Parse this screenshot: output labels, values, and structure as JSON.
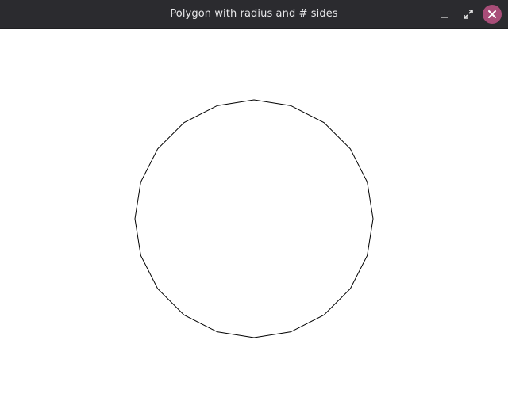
{
  "window": {
    "title": "Polygon with radius and # sides",
    "controls": {
      "minimize_icon": "minimize-icon",
      "maximize_icon": "maximize-icon",
      "close_icon": "close-icon",
      "close_color": "#a84d78"
    }
  },
  "canvas": {
    "background": "#ffffff",
    "polygon": {
      "sides": 20,
      "stroke_color": "#000000",
      "fill": "none"
    }
  }
}
